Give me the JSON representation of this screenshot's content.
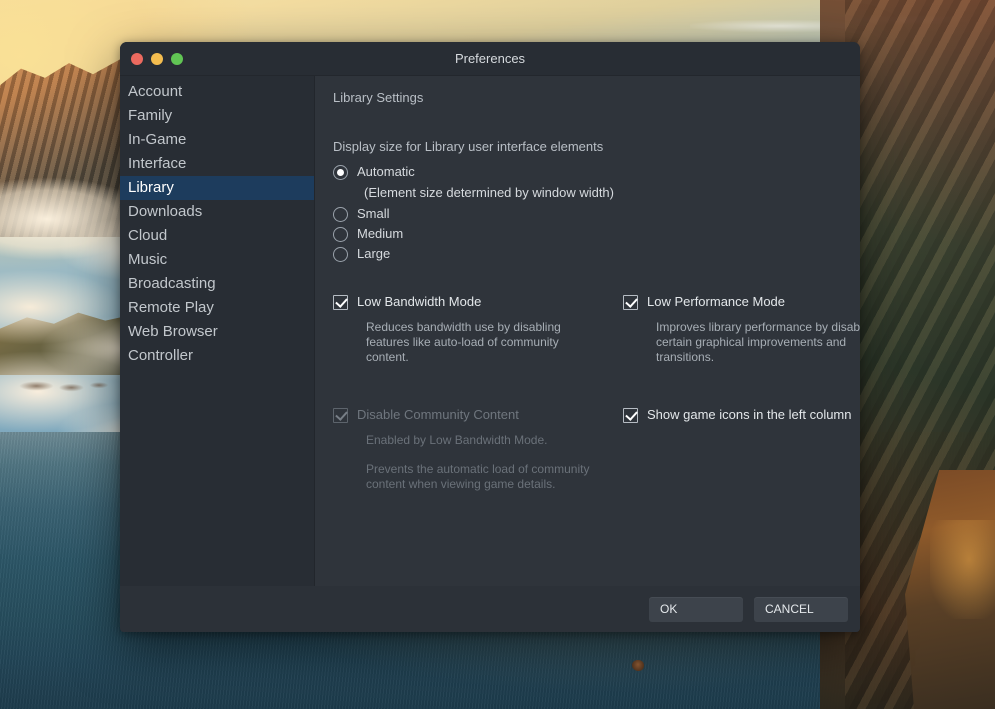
{
  "window": {
    "title": "Preferences",
    "traffic_lights": [
      {
        "name": "close",
        "color": "#ec6a5f"
      },
      {
        "name": "minimize",
        "color": "#f4bd4f"
      },
      {
        "name": "maximize",
        "color": "#61c554"
      }
    ]
  },
  "sidebar": {
    "items": [
      {
        "label": "Account",
        "selected": false
      },
      {
        "label": "Family",
        "selected": false
      },
      {
        "label": "In-Game",
        "selected": false
      },
      {
        "label": "Interface",
        "selected": false
      },
      {
        "label": "Library",
        "selected": true
      },
      {
        "label": "Downloads",
        "selected": false
      },
      {
        "label": "Cloud",
        "selected": false
      },
      {
        "label": "Music",
        "selected": false
      },
      {
        "label": "Broadcasting",
        "selected": false
      },
      {
        "label": "Remote Play",
        "selected": false
      },
      {
        "label": "Web Browser",
        "selected": false
      },
      {
        "label": "Controller",
        "selected": false
      }
    ],
    "selected_label": "Library",
    "selected_color": "#1d3c5d"
  },
  "content": {
    "section_title": "Library Settings",
    "display_size": {
      "label": "Display size for Library user interface elements",
      "selected": "Automatic",
      "options": [
        {
          "label": "Automatic",
          "selected": true,
          "sub": "(Element size determined by window width)"
        },
        {
          "label": "Small",
          "selected": false,
          "sub": ""
        },
        {
          "label": "Medium",
          "selected": false,
          "sub": ""
        },
        {
          "label": "Large",
          "selected": false,
          "sub": ""
        }
      ]
    },
    "left_column": {
      "low_bandwidth": {
        "label": "Low Bandwidth Mode",
        "checked": true,
        "enabled": true,
        "description": "Reduces bandwidth use by disabling features like auto-load of community content."
      },
      "disable_community": {
        "label": "Disable Community Content",
        "checked": true,
        "enabled": false,
        "note": "Enabled by Low Bandwidth Mode.",
        "description": "Prevents the automatic load of community content when viewing game details."
      }
    },
    "right_column": {
      "low_performance": {
        "label": "Low Performance Mode",
        "checked": true,
        "enabled": true,
        "description": "Improves library performance by disabling certain graphical improvements and transitions."
      },
      "show_game_icons": {
        "label": "Show game icons in the left column",
        "checked": true,
        "enabled": true
      }
    }
  },
  "footer": {
    "ok_label": "OK",
    "cancel_label": "CANCEL"
  }
}
